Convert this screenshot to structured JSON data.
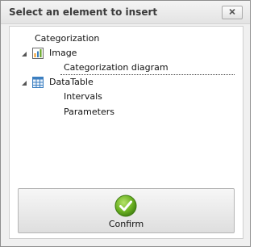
{
  "dialog": {
    "title": "Select an element to insert",
    "close_icon": "close-x-icon"
  },
  "tree": {
    "root_label": "Categorization",
    "nodes": [
      {
        "label": "Image",
        "icon": "bar-chart-icon",
        "expanded": true,
        "children": [
          {
            "label": "Categorization diagram",
            "selected": true
          }
        ]
      },
      {
        "label": "DataTable",
        "icon": "table-grid-icon",
        "expanded": true,
        "children": [
          {
            "label": "Intervals"
          },
          {
            "label": "Parameters"
          }
        ]
      }
    ]
  },
  "confirm": {
    "label": "Confirm",
    "icon": "green-check-icon"
  },
  "colors": {
    "accent_green": "#5ea01a",
    "bar_orange": "#f39a1e",
    "table_blue": "#3c7fc0"
  }
}
